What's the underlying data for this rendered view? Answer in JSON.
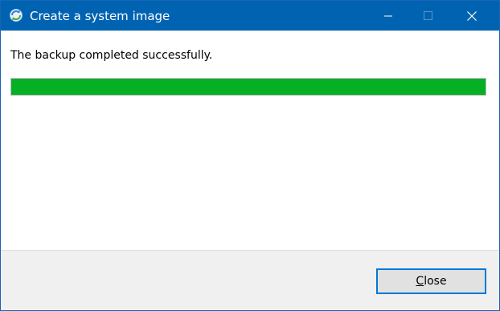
{
  "window": {
    "title": "Create a system image",
    "icon": "backup-restore-icon",
    "controls": {
      "minimize_icon": "minimize-icon",
      "maximize_icon": "maximize-icon",
      "close_icon": "close-icon"
    }
  },
  "main": {
    "message": "The backup completed successfully.",
    "progress": {
      "percent": 100,
      "color": "#06b025"
    }
  },
  "footer": {
    "close_button": {
      "accelerator": "C",
      "rest": "lose"
    }
  },
  "colors": {
    "titlebar": "#0063b1",
    "button_focus_border": "#0078d7"
  }
}
